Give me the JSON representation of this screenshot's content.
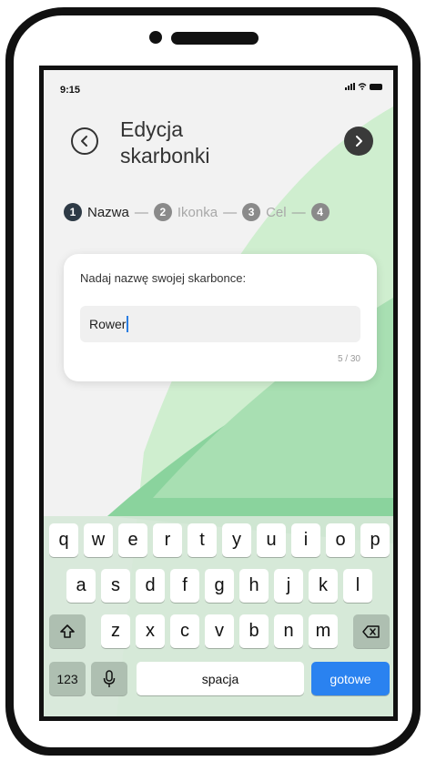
{
  "status_bar": {
    "time": "9:15"
  },
  "header": {
    "title_line1": "Edycja",
    "title_line2": "skarbonki"
  },
  "steps": [
    {
      "number": "1",
      "label": "Nazwa",
      "state": "active"
    },
    {
      "number": "2",
      "label": "Ikonka",
      "state": "inactive"
    },
    {
      "number": "3",
      "label": "Cel",
      "state": "inactive"
    },
    {
      "number": "4",
      "label": "",
      "state": "inactive"
    }
  ],
  "step_separator": "—",
  "card": {
    "label": "Nadaj nazwę swojej skarbonce:",
    "input_value": "Rower",
    "char_count": "5 / 30"
  },
  "keyboard": {
    "row1": [
      "q",
      "w",
      "e",
      "r",
      "t",
      "y",
      "u",
      "i",
      "o",
      "p"
    ],
    "row2": [
      "a",
      "s",
      "d",
      "f",
      "g",
      "h",
      "j",
      "k",
      "l"
    ],
    "row3": [
      "z",
      "x",
      "c",
      "v",
      "b",
      "n",
      "m"
    ],
    "numbers_key": "123",
    "space_key": "spacja",
    "done_key": "gotowe"
  },
  "colors": {
    "accent_green_light": "#c8e8cd",
    "accent_green_mid": "#a5dcae",
    "accent_green": "#72cc8e",
    "step_active": "#2e3a46",
    "done_key_blue": "#2a82f0"
  },
  "icons": [
    "back-arrow-icon",
    "next-arrow-icon",
    "shift-icon",
    "backspace-icon",
    "microphone-icon",
    "signal-icon",
    "wifi-icon",
    "battery-icon"
  ]
}
